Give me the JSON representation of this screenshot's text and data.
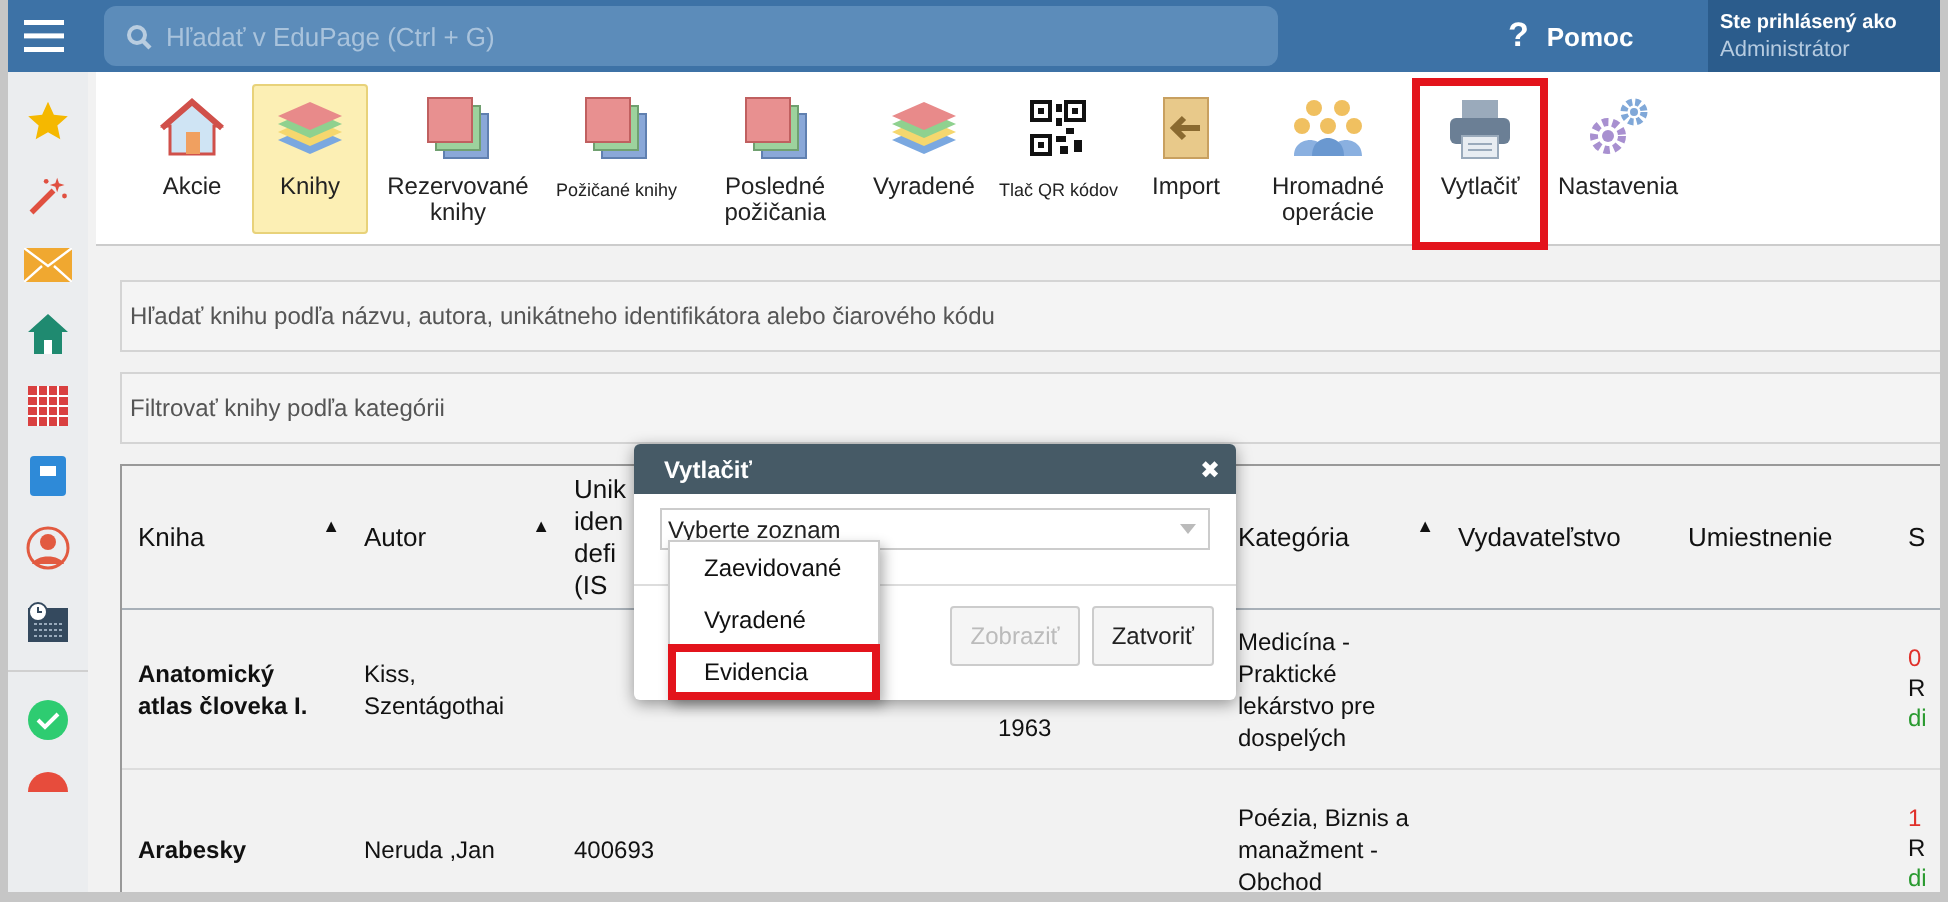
{
  "top_bar": {
    "search_placeholder": "Hľadať v EduPage (Ctrl + G)",
    "help_icon": "?",
    "help_label": "Pomoc",
    "account_caption": "Ste prihlásený ako",
    "account_name": "Administrátor"
  },
  "sidebar": {
    "items": [
      {
        "kind": "star"
      },
      {
        "kind": "wand"
      },
      {
        "kind": "mail"
      },
      {
        "kind": "home"
      },
      {
        "kind": "grid"
      },
      {
        "kind": "notebook"
      },
      {
        "kind": "person"
      },
      {
        "kind": "schedule"
      },
      {
        "kind": "check"
      },
      {
        "kind": "stop"
      }
    ]
  },
  "toolbar": {
    "items": [
      {
        "kind": "house",
        "label": "Akcie",
        "selected": false,
        "highlighted": false,
        "small": false
      },
      {
        "kind": "books",
        "label": "Knihy",
        "selected": true,
        "highlighted": false,
        "small": false
      },
      {
        "kind": "cards",
        "label": "Rezervované knihy",
        "selected": false,
        "highlighted": false,
        "small": false
      },
      {
        "kind": "cards",
        "label": "Požičané knihy",
        "selected": false,
        "highlighted": false,
        "small": true
      },
      {
        "kind": "cards",
        "label": "Posledné požičania",
        "selected": false,
        "highlighted": false,
        "small": false
      },
      {
        "kind": "books",
        "label": "Vyradené",
        "selected": false,
        "highlighted": false,
        "small": false
      },
      {
        "kind": "qr",
        "label": "Tlač QR kódov",
        "selected": false,
        "highlighted": false,
        "small": true
      },
      {
        "kind": "import",
        "label": "Import",
        "selected": false,
        "highlighted": false,
        "small": false
      },
      {
        "kind": "people",
        "label": "Hromadné operácie",
        "selected": false,
        "highlighted": false,
        "small": false
      },
      {
        "kind": "printer",
        "label": "Vytlačiť",
        "selected": false,
        "highlighted": true,
        "small": false
      },
      {
        "kind": "gears",
        "label": "Nastavenia",
        "selected": false,
        "highlighted": false,
        "small": false
      }
    ]
  },
  "book_search": {
    "placeholder": "Hľadať knihu podľa názvu, autora, unikátneho identifikátora alebo čiarového kódu"
  },
  "category_filter": {
    "placeholder": "Filtrovať knihy podľa kategórii"
  },
  "table": {
    "columns": [
      {
        "label": "Kniha",
        "sort_mark": "▲"
      },
      {
        "label": "Autor",
        "sort_mark": "▲"
      },
      {
        "label": "Unik\niden\ndefi\n(IS"
      },
      {},
      {
        "label": "Kategória",
        "sort_mark": "▲"
      },
      {
        "label": "Vydavateľstvo"
      },
      {
        "label": "Umiestnenie"
      },
      {
        "label": "S"
      }
    ],
    "rows": [
      {
        "cells": [
          "Anatomický atlas človeka I.",
          "Kiss, Szentágothai",
          "",
          "1963",
          "Medicína - Praktické lekárstvo pre dospelých",
          "",
          "",
          ""
        ],
        "status": {
          "count": "0",
          "line_2": "R",
          "line_3": "di"
        }
      },
      {
        "cells": [
          "Arabesky",
          "Neruda ,Jan",
          "400693",
          "",
          "Poézia, Biznis a manažment - Obchod",
          "",
          "",
          ""
        ],
        "status": {
          "count": "1",
          "line_2": "R",
          "line_3": "di"
        }
      }
    ]
  },
  "dialog": {
    "title": "Vytlačiť",
    "close": "✖",
    "select_placeholder": "Vyberte zoznam",
    "options": [
      {
        "label": "Zaevidované",
        "highlighted": false
      },
      {
        "label": "Vyradené",
        "highlighted": false
      },
      {
        "label": "Evidencia",
        "highlighted": true
      }
    ],
    "buttons": [
      {
        "label": "Zobraziť",
        "disabled": true
      },
      {
        "label": "Zatvoriť",
        "disabled": false
      }
    ]
  }
}
